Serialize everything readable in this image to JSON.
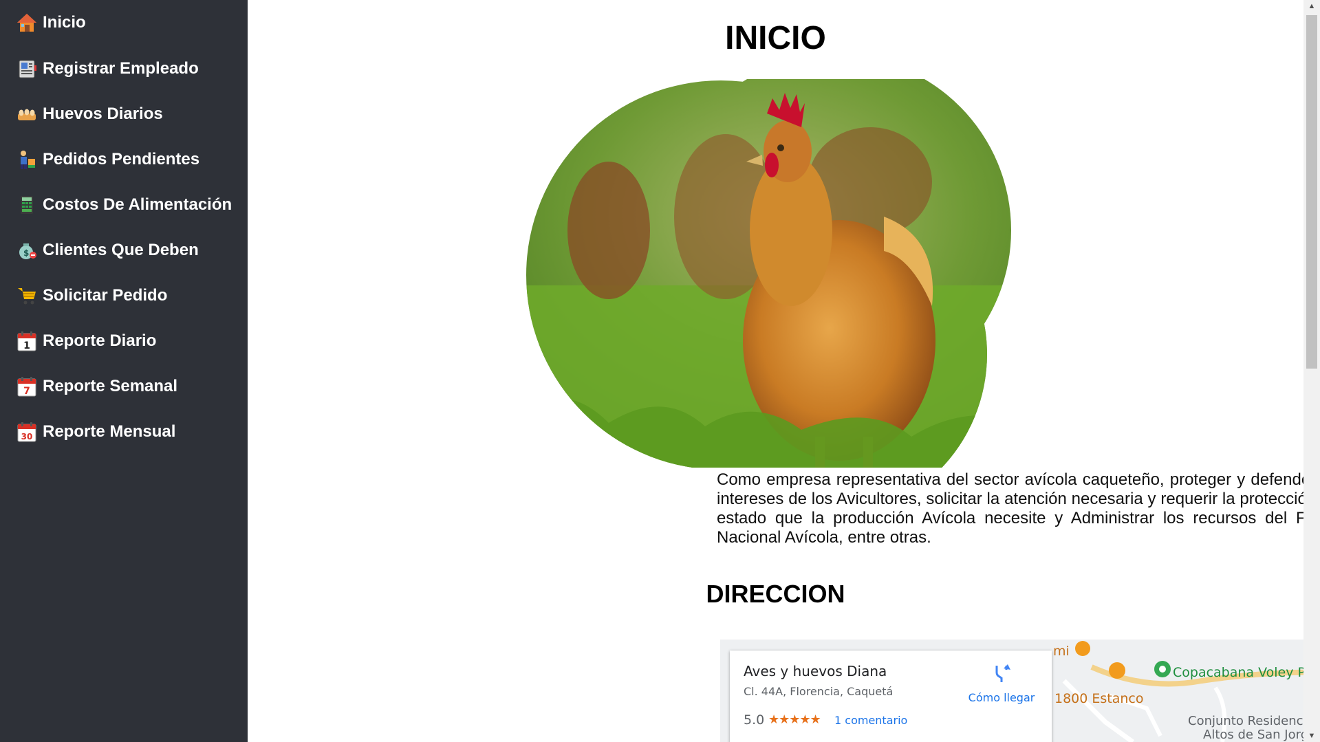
{
  "sidebar": {
    "items": [
      {
        "label": "Inicio",
        "icon": "house-icon"
      },
      {
        "label": "Registrar Empleado",
        "icon": "id-card-icon"
      },
      {
        "label": "Huevos Diarios",
        "icon": "egg-tray-icon"
      },
      {
        "label": "Pedidos Pendientes",
        "icon": "delivery-person-icon"
      },
      {
        "label": "Costos De Alimentación",
        "icon": "calculator-icon"
      },
      {
        "label": "Clientes Que Deben",
        "icon": "money-bag-icon"
      },
      {
        "label": "Solicitar Pedido",
        "icon": "shopping-cart-icon"
      },
      {
        "label": "Reporte Diario",
        "icon": "calendar-1-icon",
        "day": "1"
      },
      {
        "label": "Reporte Semanal",
        "icon": "calendar-7-icon",
        "day": "7"
      },
      {
        "label": "Reporte Mensual",
        "icon": "calendar-30-icon",
        "day": "30"
      }
    ]
  },
  "main": {
    "title": "INICIO",
    "description": "Como empresa representativa del sector avícola caqueteño, proteger y defender los intereses de los Avicultores, solicitar la atención necesaria y requerir la protección del estado que la producción Avícola necesite y Administrar los recursos del Fondo Nacional Avícola, entre otras.",
    "address_title": "DIRECCION"
  },
  "map": {
    "place_name": "Aves y huevos Diana",
    "address": "Cl. 44A, Florencia, Caquetá",
    "rating": "5.0",
    "stars": "★★★★★",
    "reviews": "1 comentario",
    "directions": "Cómo llegar",
    "labels": {
      "poi1": "Copacabana Voley PLaya",
      "poi2": "1800 Estanco",
      "poi3_line1": "Conjunto Residencial",
      "poi3_line2": "Altos de San Jorge",
      "poi4": "mi"
    }
  },
  "colors": {
    "sidebar_bg": "#2e3138",
    "link_blue": "#1a73e8",
    "star_orange": "#e7711b"
  }
}
